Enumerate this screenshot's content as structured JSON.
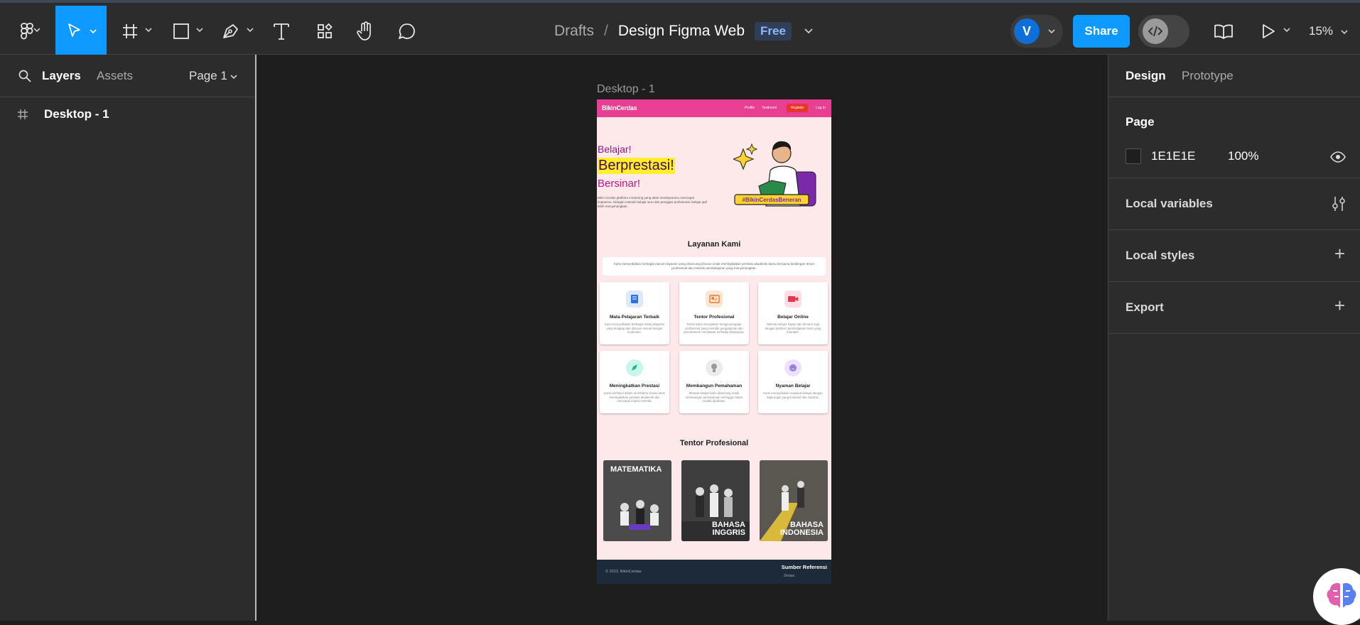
{
  "toolbar": {
    "breadcrumb_root": "Drafts",
    "breadcrumb_sep": "/",
    "file_name": "Design Figma Web",
    "plan_badge": "Free",
    "avatar_letter": "V",
    "share_label": "Share",
    "zoom": "15%",
    "tools": [
      "figma-menu-icon",
      "move-icon",
      "frame-icon",
      "rectangle-icon",
      "pen-icon",
      "text-icon",
      "resources-icon",
      "hand-icon",
      "comment-icon"
    ]
  },
  "left_panel": {
    "tab_layers": "Layers",
    "tab_assets": "Assets",
    "page_selector": "Page 1",
    "layers": [
      {
        "name": "Desktop - 1",
        "type": "frame"
      }
    ]
  },
  "right_panel": {
    "tab_design": "Design",
    "tab_prototype": "Prototype",
    "page_heading": "Page",
    "page_color": "1E1E1E",
    "page_opacity": "100%",
    "local_variables": "Local variables",
    "local_styles": "Local styles",
    "export": "Export"
  },
  "canvas": {
    "frame_label": "Desktop - 1",
    "site": {
      "logo": "BikinCerdas",
      "nav": [
        "Profile",
        "Testimoni",
        "Register",
        "Log In"
      ],
      "hero_line1": "Belajar!",
      "hero_line2": "Berprestasi!",
      "hero_line3": "Bersinar!",
      "hero_desc": "Bikin Cerdas platform e-learning yang akan membantumu mencapai impianmu. Dengan metode belajar seru dan pengajar profesional, belajar jadi lebih menyenangkan.",
      "hero_tag": "#BikinCerdasBeneran",
      "services_title": "Layanan Kami",
      "services_desc": "Kami menyediakan berbagai macam layanan yang dirancang khusus untuk meningkatkan prestasi akademik kamu bersama bimbingan tentor profesional dan metode pembelajaran yang menyenangkan.",
      "services": [
        {
          "title": "Mata Pelajaran Terbaik",
          "desc": "Kami menyediakan berbagai mata pelajaran yang lengkap dan disusun sesuai dengan kurikulum."
        },
        {
          "title": "Tentor Profesional",
          "desc": "Tentor kami merupakan tenaga pengajar profesional yang memiliki pengalaman dan pemahaman mendalam terhadap bidangnya."
        },
        {
          "title": "Belajar Online",
          "desc": "Nikmati belajar kapan dan dimana saja dengan platform pembelajaran kami yang interaktif."
        },
        {
          "title": "Meningkatkan Prestasi",
          "desc": "Kami berfokus dalam membantu siswa untuk meningkatkan prestasi akademik dan mencapai impian mereka."
        },
        {
          "title": "Membangun Pemahaman",
          "desc": "Metode belajar kami dirancang untuk membangun pemahaman sehingga materi mudah dipahami."
        },
        {
          "title": "Nyaman Belajar",
          "desc": "Kami menyediakan suasana belajar dengan lingkungan yang kondusif dan nyaman."
        }
      ],
      "tentor_title": "Tentor Profesional",
      "photos": [
        {
          "caption": "MATEMATIKA"
        },
        {
          "caption": "BAHASA\nINGGRIS"
        },
        {
          "caption": "BAHASA\nINDONESIA"
        }
      ],
      "footer_copy": "© 2023. BikinCerdas",
      "footer_heading": "Sumber Referensi",
      "footer_link": "Zenius"
    }
  },
  "colors": {
    "accent": "#0D99FF",
    "site_pink": "#E93F93",
    "hero_highlight": "#FFEF2A"
  }
}
